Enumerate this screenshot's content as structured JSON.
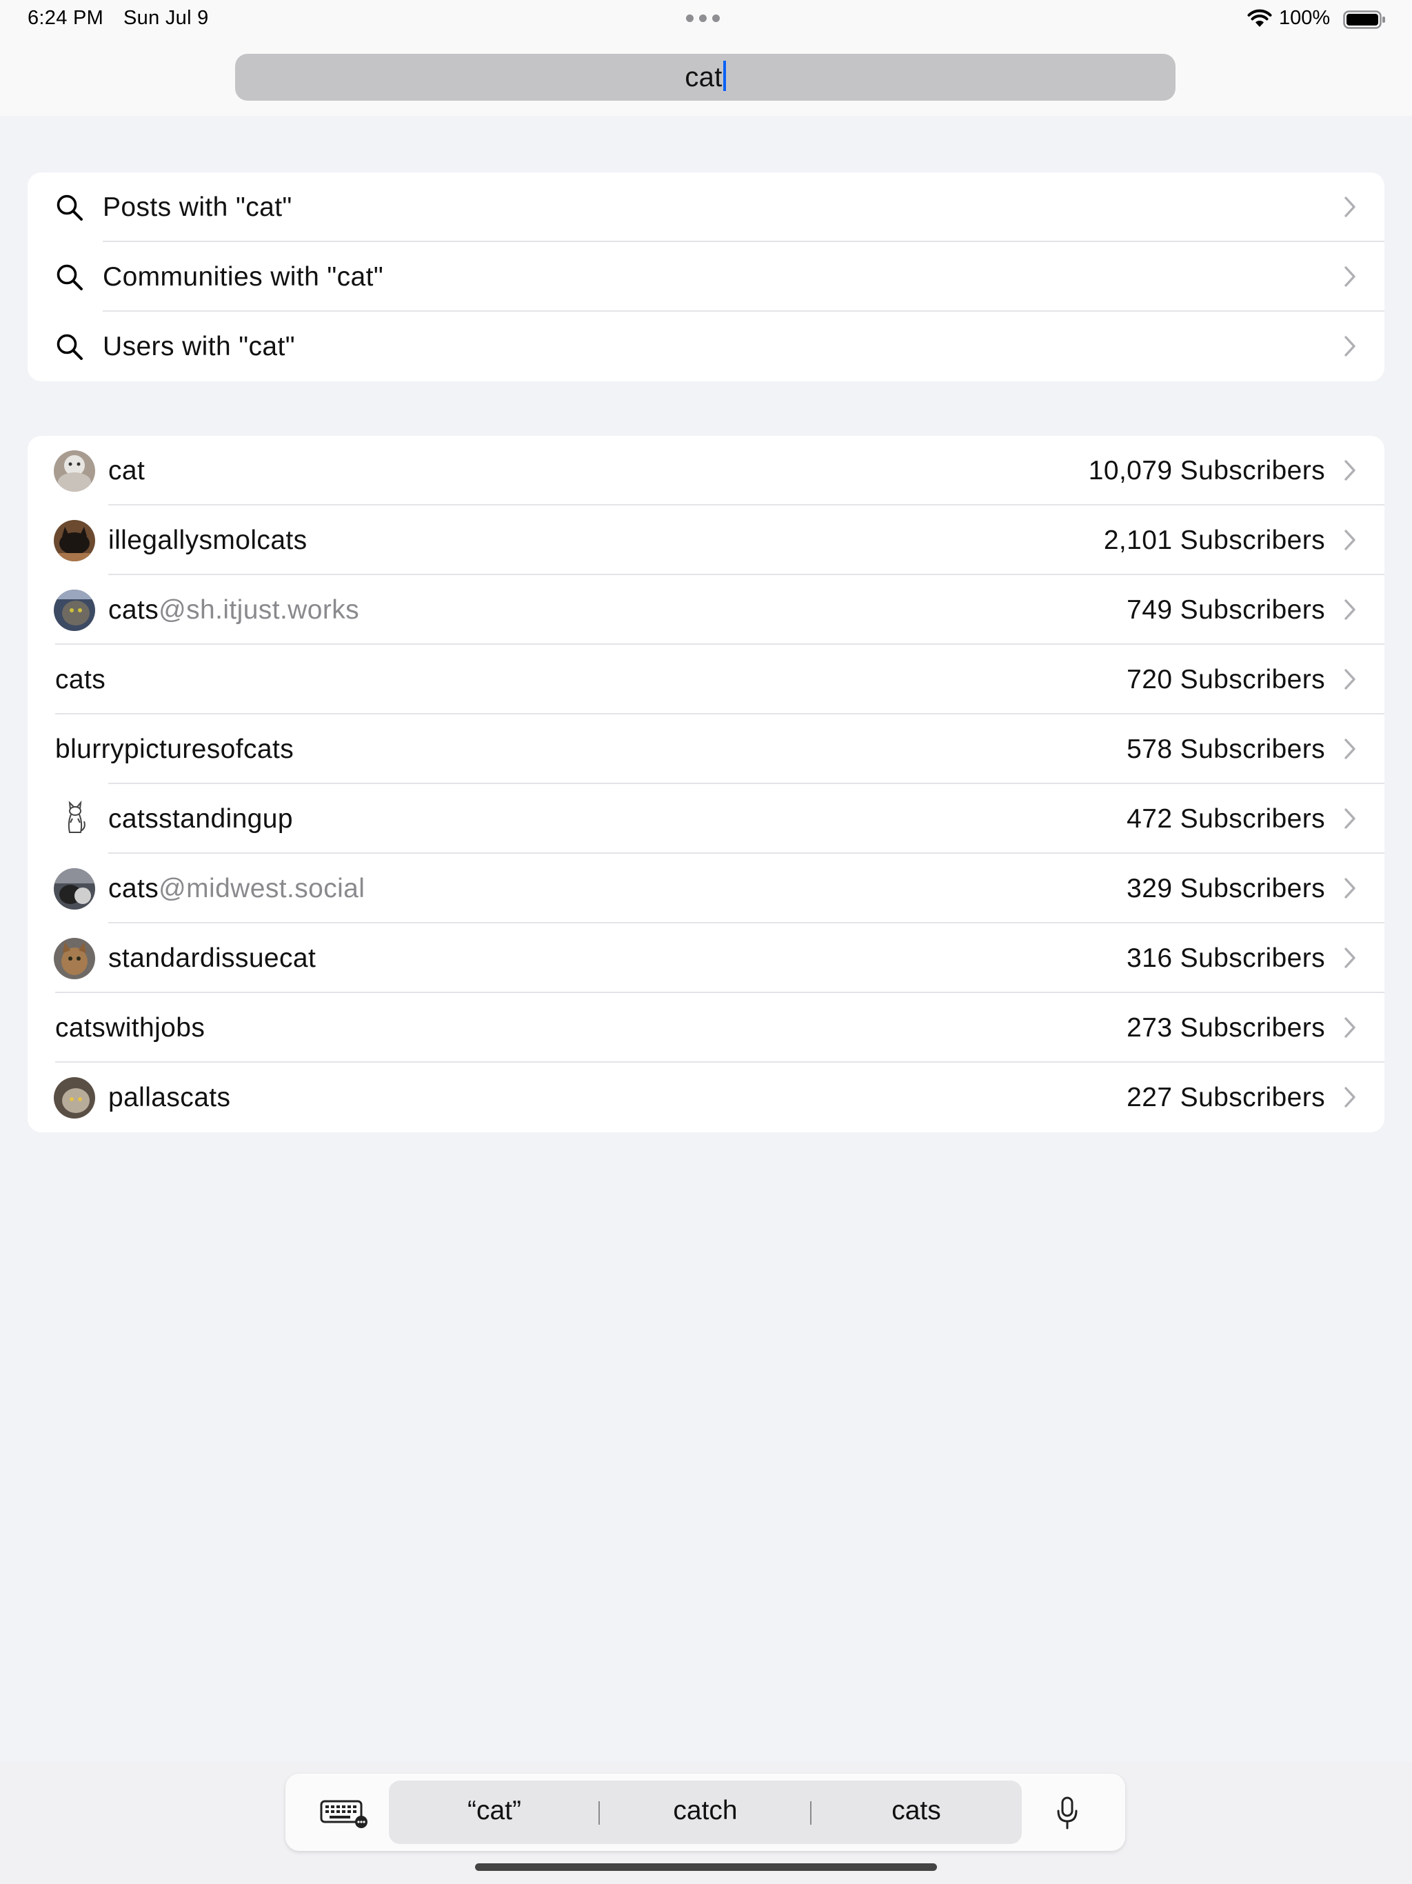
{
  "status_bar": {
    "time": "6:24 PM",
    "date": "Sun Jul 9",
    "battery_percent": "100%",
    "icons": [
      "wifi-icon",
      "battery-icon",
      "multitasking-dots-icon"
    ]
  },
  "search": {
    "value": "cat"
  },
  "search_options": [
    {
      "label": "Posts with \"cat\"",
      "icon": "search-icon"
    },
    {
      "label": "Communities with \"cat\"",
      "icon": "search-icon"
    },
    {
      "label": "Users with \"cat\"",
      "icon": "search-icon"
    }
  ],
  "communities": [
    {
      "name": "cat",
      "host": "",
      "subscribers": "10,079 Subscribers",
      "avatar": "photo"
    },
    {
      "name": "illegallysmolcats",
      "host": "",
      "subscribers": "2,101 Subscribers",
      "avatar": "photo"
    },
    {
      "name": "cats",
      "host": "@sh.itjust.works",
      "subscribers": "749 Subscribers",
      "avatar": "photo"
    },
    {
      "name": "cats",
      "host": "",
      "subscribers": "720 Subscribers",
      "avatar": "none"
    },
    {
      "name": "blurrypicturesofcats",
      "host": "",
      "subscribers": "578 Subscribers",
      "avatar": "none"
    },
    {
      "name": "catsstandingup",
      "host": "",
      "subscribers": "472 Subscribers",
      "avatar": "drawing"
    },
    {
      "name": "cats",
      "host": "@midwest.social",
      "subscribers": "329 Subscribers",
      "avatar": "photo"
    },
    {
      "name": "standardissuecat",
      "host": "",
      "subscribers": "316 Subscribers",
      "avatar": "photo"
    },
    {
      "name": "catswithjobs",
      "host": "",
      "subscribers": "273 Subscribers",
      "avatar": "none"
    },
    {
      "name": "pallascats",
      "host": "",
      "subscribers": "227 Subscribers",
      "avatar": "photo"
    }
  ],
  "keyboard_bar": {
    "suggestions": [
      "“cat”",
      "catch",
      "cats"
    ],
    "icons": [
      "keyboard-icon",
      "microphone-icon"
    ]
  },
  "colors": {
    "background": "#f2f3f7",
    "card": "#ffffff",
    "caret": "#0a62f5",
    "secondary_text": "#8a8a8e"
  }
}
